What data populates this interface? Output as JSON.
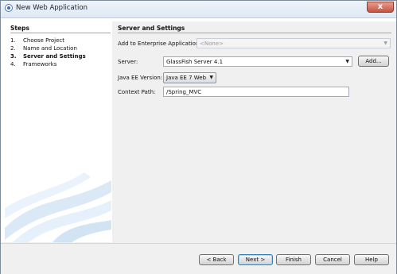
{
  "window": {
    "title": "New Web Application",
    "close_glyph": "x"
  },
  "steps": {
    "title": "Steps",
    "items": [
      {
        "num": "1.",
        "label": "Choose Project"
      },
      {
        "num": "2.",
        "label": "Name and Location"
      },
      {
        "num": "3.",
        "label": "Server and Settings",
        "current": true
      },
      {
        "num": "4.",
        "label": "Frameworks"
      }
    ]
  },
  "panel": {
    "title": "Server and Settings",
    "enterprise_label": "Add to Enterprise Application:",
    "enterprise_value": "<None>",
    "server_label": "Server:",
    "server_value": "GlassFish Server 4.1",
    "add_button": "Add...",
    "javaee_label": "Java EE Version:",
    "javaee_value": "Java EE 7 Web",
    "context_label": "Context Path:",
    "context_value": "/Spring_MVC"
  },
  "buttons": {
    "back": "< Back",
    "next": "Next >",
    "finish": "Finish",
    "cancel": "Cancel",
    "help": "Help"
  },
  "colors": {
    "accent": "#3d6fb0",
    "close": "#c65340"
  }
}
